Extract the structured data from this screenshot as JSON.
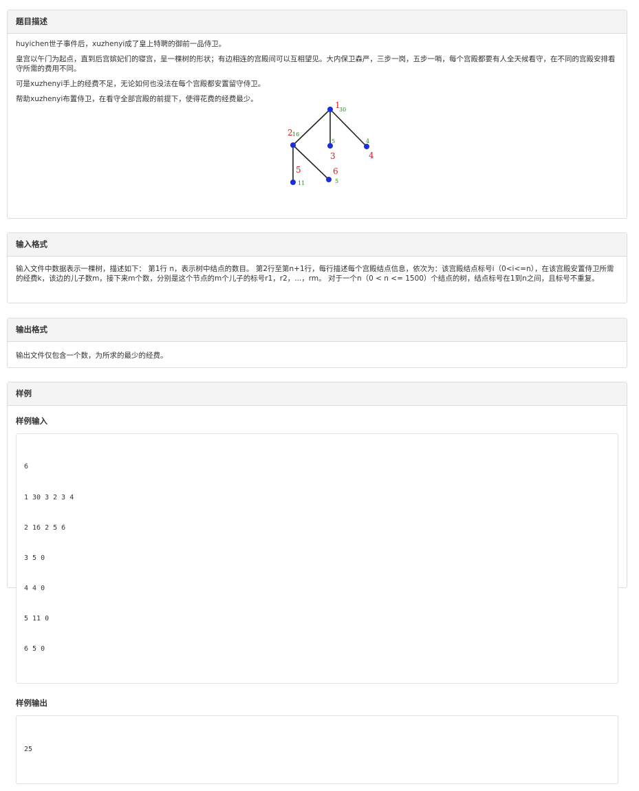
{
  "sections": {
    "description": {
      "title": "题目描述",
      "paragraphs": [
        "huyichen世子事件后，xuzhenyi成了皇上特聘的御前一品侍卫。",
        "皇宫以午门为起点，直到后宫嫔妃们的寝宫，呈一棵树的形状；有边相连的宫殿间可以互相望见。大内保卫森严，三步一岗，五步一哨，每个宫殿都要有人全天候看守，在不同的宫殿安排看守所需的费用不同。",
        "可是xuzhenyi手上的经费不足，无论如何也没法在每个宫殿都安置留守侍卫。",
        "帮助xuzhenyi布置侍卫，在看守全部宫殿的前提下，使得花费的经费最少。"
      ],
      "tree_figure": {
        "nodes": [
          {
            "id": "1",
            "cost": "30"
          },
          {
            "id": "2",
            "cost": "16"
          },
          {
            "id": "3",
            "cost": "5"
          },
          {
            "id": "4",
            "cost": "4"
          },
          {
            "id": "5",
            "cost": "11"
          },
          {
            "id": "6",
            "cost": "5"
          }
        ],
        "edges": [
          [
            "1",
            "2"
          ],
          [
            "1",
            "3"
          ],
          [
            "1",
            "4"
          ],
          [
            "2",
            "5"
          ],
          [
            "2",
            "6"
          ]
        ],
        "colors": {
          "node": "#1a2fd6",
          "edge": "#222222",
          "id_label": "#e21b1b",
          "cost_label": "#1a8a1a"
        }
      }
    },
    "input_format": {
      "title": "输入格式",
      "text": "输入文件中数据表示一棵树，描述如下：  第1行 n，表示树中结点的数目。  第2行至第n+1行，每行描述每个宫殿结点信息，依次为：该宫殿结点标号i（0<i<=n），在该宫殿安置侍卫所需的经费k，该边的儿子数m，接下来m个数，分别是这个节点的m个儿子的标号r1，r2，...，rm。  对于一个n（0 < n <= 1500）个结点的树，结点标号在1到n之间，且标号不重复。"
    },
    "output_format": {
      "title": "输出格式",
      "text": "输出文件仅包含一个数，为所求的最少的经费。"
    },
    "sample": {
      "title": "样例",
      "input_title": "样例输入",
      "input_lines": [
        "6",
        "1 30 3 2 3 4",
        "2 16 2 5 6",
        "3 5 0",
        "4 4 0",
        "5 11 0",
        "6 5 0"
      ],
      "output_title": "样例输出",
      "output_lines": [
        "25"
      ]
    }
  }
}
